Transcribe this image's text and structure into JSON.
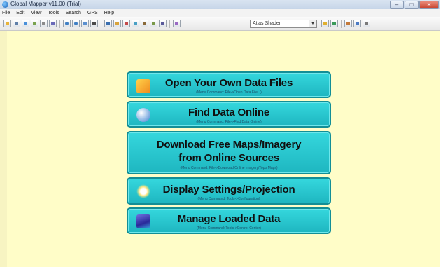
{
  "window": {
    "title": "Global Mapper v11.00 (Trial)",
    "controls": [
      "–",
      "□",
      "✕"
    ]
  },
  "menu": [
    "File",
    "Edit",
    "View",
    "Tools",
    "Search",
    "GPS",
    "Help"
  ],
  "toolbar": {
    "shader_select": "Atlas Shader"
  },
  "start_buttons": [
    {
      "label": "Open Your Own Data Files",
      "sub": "(Menu Command: File->Open Data File...)",
      "icon": "open-folder-icon"
    },
    {
      "label": "Find Data Online",
      "sub": "(Menu Command: File->Find Data Online)",
      "icon": "globe-search-icon"
    },
    {
      "label_line1": "Download Free Maps/Imagery",
      "label_line2": "from Online Sources",
      "sub": "(Menu Command: File->Download Online Imagery/Topo Maps)",
      "icon": ""
    },
    {
      "label": "Display Settings/Projection",
      "sub": "(Menu Command: Tools->Configuration)",
      "icon": "settings-sun-icon"
    },
    {
      "label": "Manage Loaded Data",
      "sub": "(Menu Command: Tools->Control Center)",
      "icon": "layers-icon"
    }
  ],
  "colors": {
    "canvas_bg": "#fffdc8",
    "button_fill": "#27c6cf",
    "button_border": "#138e96"
  }
}
